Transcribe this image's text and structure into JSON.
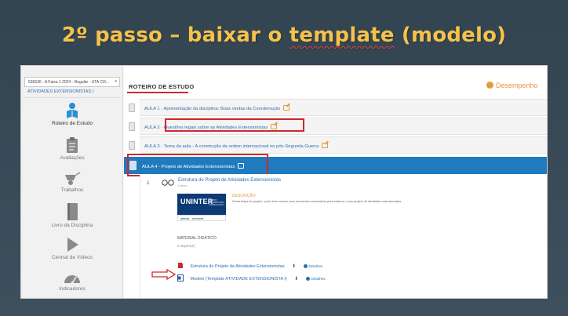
{
  "slide": {
    "title_before": "2º passo – baixar o ",
    "title_underlined": "template",
    "title_after": " (modelo)"
  },
  "sidebar": {
    "course_select_value": "536536 - A Faixa 1 2024 - Regular - UTA CO...",
    "course_sub": "ATIVIDADES EXTENSIONISTAS I",
    "items": [
      {
        "label": "Roteiro de Estudo",
        "icon": "person-book-icon"
      },
      {
        "label": "Avaliações",
        "icon": "clipboard-icon"
      },
      {
        "label": "Trabalhos",
        "icon": "wheelbarrow-icon"
      },
      {
        "label": "Livro da Disciplina",
        "icon": "book-icon"
      },
      {
        "label": "Central de Vídeos",
        "icon": "play-icon"
      },
      {
        "label": "Indicadores",
        "icon": "gauge-icon"
      }
    ]
  },
  "main": {
    "section_title": "ROTEIRO DE ESTUDO",
    "performance_label": "Desempenho",
    "aulas": [
      {
        "label": "AULA 1 · Apresentação da disciplina: Boas vindas da Coordenação"
      },
      {
        "label": "AULA 2 · Questões legais sobre as Atividades Extensionistas"
      },
      {
        "label": "AULA 3 · Tema da aula - A construção da ordem internacional no pós-Segunda Guerra"
      },
      {
        "label": "AULA 4 · Projeto de Atividades Extensionistas"
      }
    ],
    "item_number": "1",
    "item_title": "Estrutura do Projeto de Atividades Extensionistas",
    "item_subtitle": "Leitura",
    "logo_text": "UNINTER",
    "logo_side_text": "CENTRO UNIVERSITÁRIO INTERNACIONAL",
    "logo_tagline": "alterar · remover",
    "description_heading": "DESCRIÇÃO",
    "description_text": "Nesta etapa do projeto, você deve colocar seus elementos necessários para elaborar o seu projeto de atividades extensionistas.",
    "material_heading": "MATERIAL DIDÁTICO",
    "material_count": "2 arquivo(s)",
    "files": [
      {
        "name": "Estrutura do Projeto de Atividades Extensionistas",
        "download_icon": "download-icon",
        "details": "Detalhes",
        "type": "pdf-icon"
      },
      {
        "name": "Modelo (Template ATIVIDADE EXTENSIONISTA I)",
        "download_icon": "download-icon",
        "details": "Detalhes",
        "type": "word-icon"
      }
    ]
  },
  "colors": {
    "background": "#3a4b58",
    "title": "#f5c24a",
    "accent_blue": "#1f7bbd",
    "highlight_red": "#d0282a",
    "orange": "#e39a3a"
  }
}
